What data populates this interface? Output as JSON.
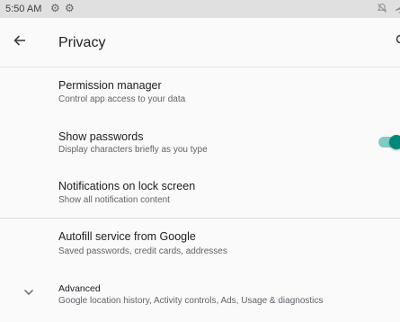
{
  "status_bar": {
    "time": "5:50 AM",
    "left_icons": [
      "gear-icon",
      "gear-icon"
    ],
    "right_icons": [
      "no-notifications-icon",
      "airplane-icon"
    ]
  },
  "app_bar": {
    "title": "Privacy",
    "back_icon": "arrow-back-icon",
    "search_icon": "search-icon"
  },
  "settings": {
    "permission_manager": {
      "title": "Permission manager",
      "summary": "Control app access to your data"
    },
    "show_passwords": {
      "title": "Show passwords",
      "summary": "Display characters briefly as you type",
      "enabled": true
    },
    "lock_screen_notifications": {
      "title": "Notifications on lock screen",
      "summary": "Show all notification content"
    },
    "autofill": {
      "title": "Autofill service from Google",
      "summary": "Saved passwords, credit cards, addresses"
    },
    "advanced": {
      "title": "Advanced",
      "summary": "Google location history, Activity controls, Ads, Usage & diagnostics",
      "icon": "chevron-down-icon"
    }
  },
  "colors": {
    "accent": "#00897b",
    "accent_track": "#80cbc4",
    "status_bar_bg": "#e0e0e0",
    "background": "#fafafa"
  }
}
